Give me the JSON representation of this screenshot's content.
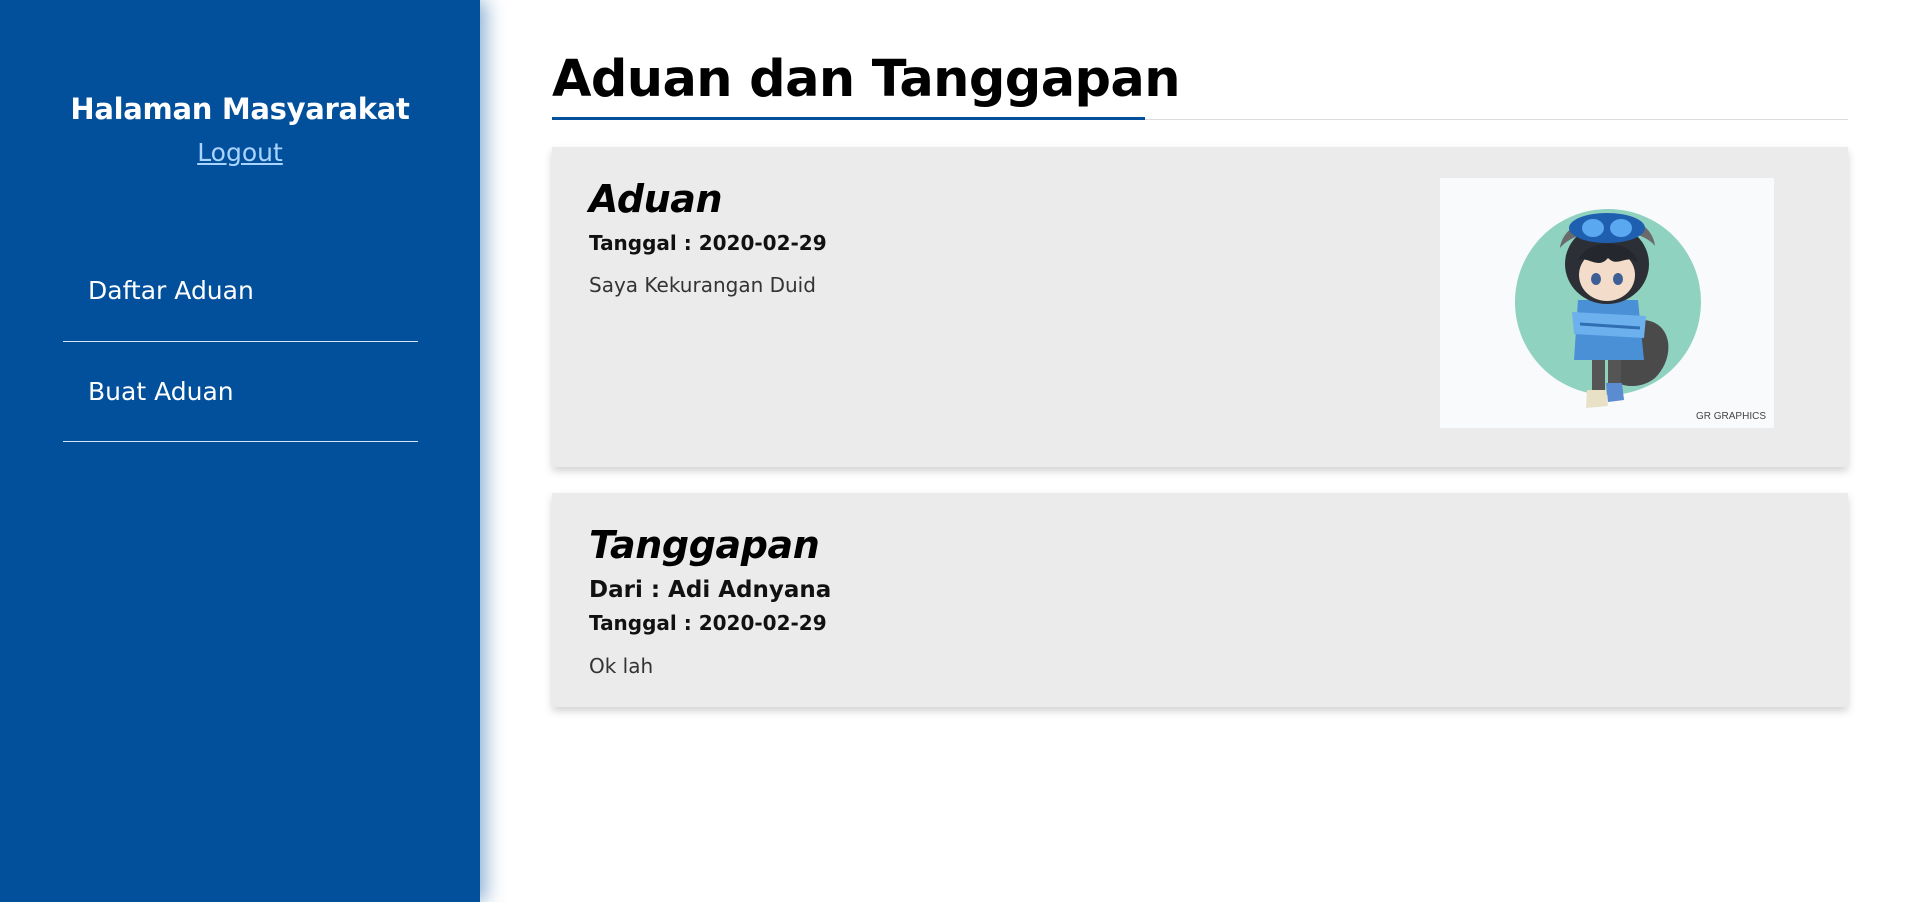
{
  "sidebar": {
    "title": "Halaman Masyarakat",
    "logout_label": "Logout",
    "items": [
      {
        "label": "Daftar Aduan"
      },
      {
        "label": "Buat Aduan"
      }
    ]
  },
  "main": {
    "page_title": "Aduan dan Tanggapan",
    "aduan": {
      "heading": "Aduan",
      "date_line": "Tanggal : 2020-02-29",
      "text": "Saya Kekurangan Duid",
      "image_watermark": "GR GRAPHICS"
    },
    "tanggapan": {
      "heading": "Tanggapan",
      "from_line": "Dari : Adi Adnyana",
      "date_line": "Tanggal : 2020-02-29",
      "text": "Ok lah"
    }
  },
  "colors": {
    "sidebar_bg": "#024f9b",
    "accent": "#024f9b",
    "card_bg": "#ebebeb",
    "logout_link": "#a9d4ff"
  }
}
